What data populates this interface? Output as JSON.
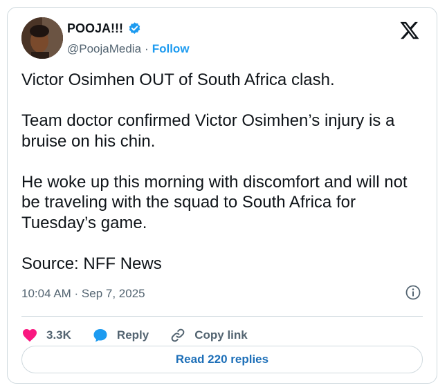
{
  "author": {
    "name": "POOJA!!!",
    "handle": "@PoojaMedia",
    "separator": "·",
    "follow_label": "Follow",
    "verified_icon": "verified-badge-icon"
  },
  "post": {
    "paragraphs": [
      "Victor Osimhen OUT of South Africa clash.",
      "Team doctor confirmed Victor Osimhen’s injury is a bruise on his chin.",
      "He woke up this morning with discomfort and will not be traveling with the squad to South Africa for Tuesday’s game.",
      "Source: NFF News"
    ],
    "timestamp": "10:04 AM · Sep 7, 2025"
  },
  "actions": {
    "like_count": "3.3K",
    "reply_label": "Reply",
    "copy_link_label": "Copy link",
    "read_replies_label": "Read 220 replies"
  },
  "colors": {
    "accent": "#1d9bf0",
    "like": "#f91880",
    "muted": "#536471",
    "border": "#cfd9de"
  }
}
